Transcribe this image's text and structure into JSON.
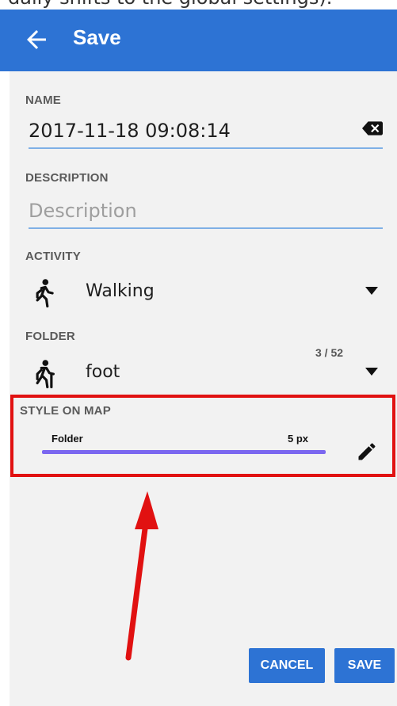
{
  "top_caption": "daily shifts to the global settings).",
  "appbar": {
    "title": "Save"
  },
  "form": {
    "name": {
      "label": "NAME",
      "value": "2017-11-18 09:08:14"
    },
    "description": {
      "label": "DESCRIPTION",
      "placeholder": "Description"
    },
    "activity": {
      "label": "ACTIVITY",
      "value": "Walking",
      "icon": "walking-person-icon"
    },
    "folder": {
      "label": "FOLDER",
      "value": "foot",
      "count": "3 / 52",
      "icon": "hiking-person-icon"
    }
  },
  "style_on_map": {
    "label": "STYLE ON MAP",
    "folder_label": "Folder",
    "width_label": "5 px",
    "line_color": "#7b67f0"
  },
  "buttons": {
    "cancel": "CANCEL",
    "save": "SAVE"
  },
  "colors": {
    "app_bar": "#2d73d4",
    "highlight": "#e11111",
    "screen_bg": "#f2f2f2"
  },
  "icons": {
    "back": "back-arrow-icon",
    "clear": "clear-text-icon",
    "dropdown": "dropdown-arrow-icon",
    "edit": "pencil-icon"
  }
}
